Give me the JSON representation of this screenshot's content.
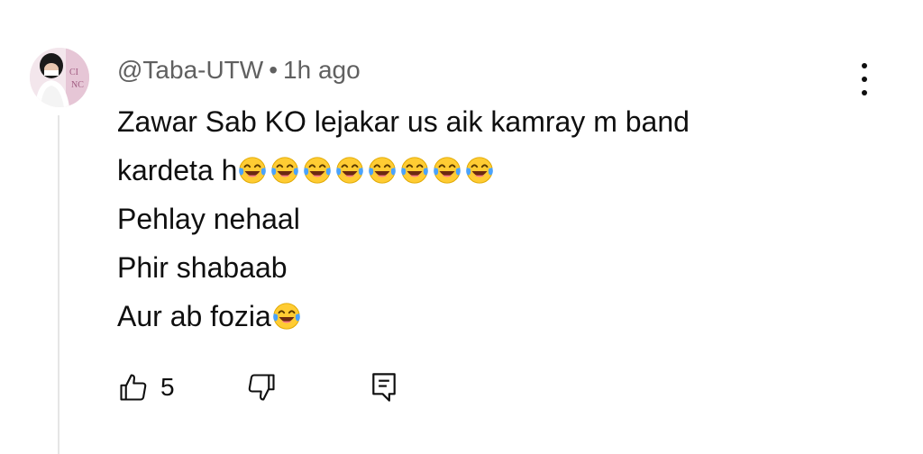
{
  "comment": {
    "author": "@Taba-UTW",
    "separator": "•",
    "time": "1h ago",
    "lines": [
      "Zawar Sab KO lejakar  us aik kamray m band",
      "kardeta h",
      "Pehlay nehaal",
      "Phir shabaab",
      "Aur ab fozia"
    ],
    "emoji_name": "face-with-tears-of-joy",
    "like_count": "5"
  },
  "icons": {
    "menu": "more-vert-icon",
    "like": "thumbs-up-icon",
    "dislike": "thumbs-down-icon",
    "reply": "reply-comment-icon"
  },
  "colors": {
    "author": "#606060",
    "text": "#0f0f0f",
    "thread_line": "#e5e5e5",
    "emoji_face": "#ffcc33"
  }
}
